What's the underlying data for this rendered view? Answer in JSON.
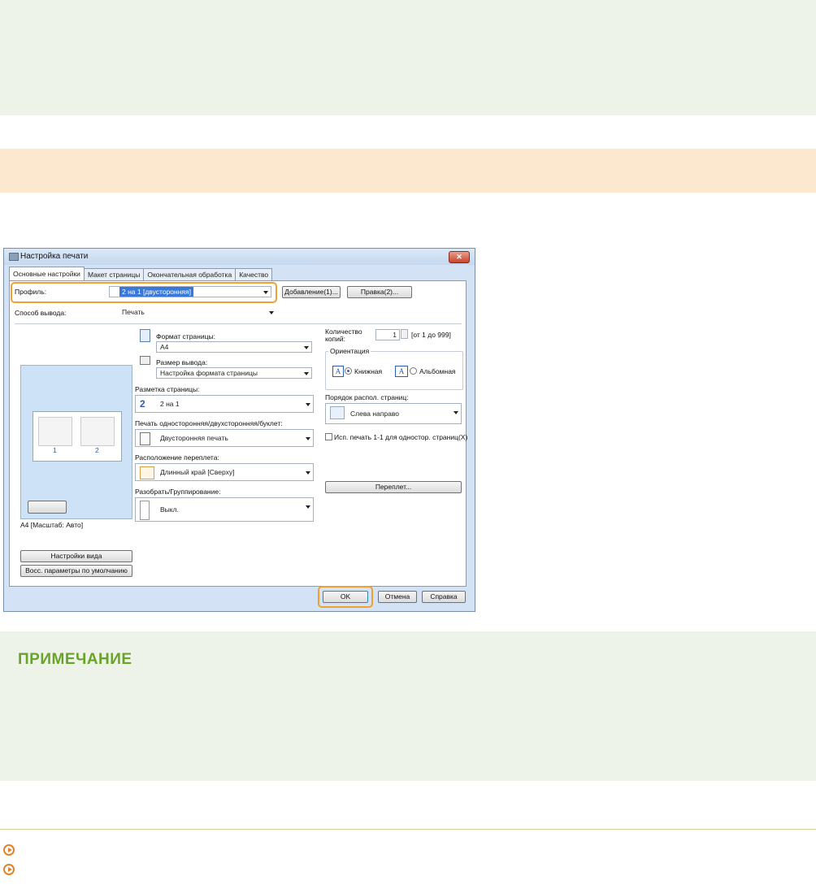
{
  "note": {
    "title": "ПРИМЕЧАНИЕ"
  },
  "dialog": {
    "title": "Настройка печати",
    "close_label": "✕",
    "tabs": [
      "Основные настройки",
      "Макет страницы",
      "Окончательная обработка",
      "Качество"
    ],
    "profile_label": "Профиль:",
    "profile_value": "2 на 1 [двусторонняя]",
    "add_button": "Добавление(1)...",
    "edit_button": "Правка(2)...",
    "output_method_label": "Способ вывода:",
    "output_method_value": "Печать",
    "page_size_label": "Формат страницы:",
    "page_size_value": "A4",
    "output_size_label": "Размер вывода:",
    "output_size_value": "Настройка формата страницы",
    "copies_label": "Количество копий:",
    "copies_value": "1",
    "copies_range": "[от 1 до 999]",
    "orientation_label": "Ориентация",
    "portrait_label": "Книжная",
    "landscape_label": "Альбомная",
    "layout_label": "Разметка страницы:",
    "layout_value": "2 на 1",
    "page_order_label": "Порядок распол. страниц:",
    "page_order_value": "Слева направо",
    "duplex_label": "Печать односторонняя/двухсторонняя/буклет:",
    "duplex_value": "Двусторонняя печать",
    "use_1_1_label": "Исп. печать 1-1 для одностор. страниц(X)",
    "binding_label": "Расположение переплета:",
    "binding_value": "Длинный край [Сверху]",
    "binding_button": "Переплет...",
    "collate_label": "Разобрать/Группирование:",
    "collate_value": "Выкл.",
    "preview_caption": "A4 [Масштаб: Авто]",
    "preview_page_numbers": [
      "1",
      "2"
    ],
    "view_settings_button": "Настройки вида",
    "restore_defaults_button": "Восс. параметры по умолчанию",
    "ok_button": "OK",
    "cancel_button": "Отмена",
    "help_button": "Справка"
  },
  "colors": {
    "highlight": "#f0a030",
    "note_title": "#6aa329",
    "link_bullet": "#e0822b"
  }
}
